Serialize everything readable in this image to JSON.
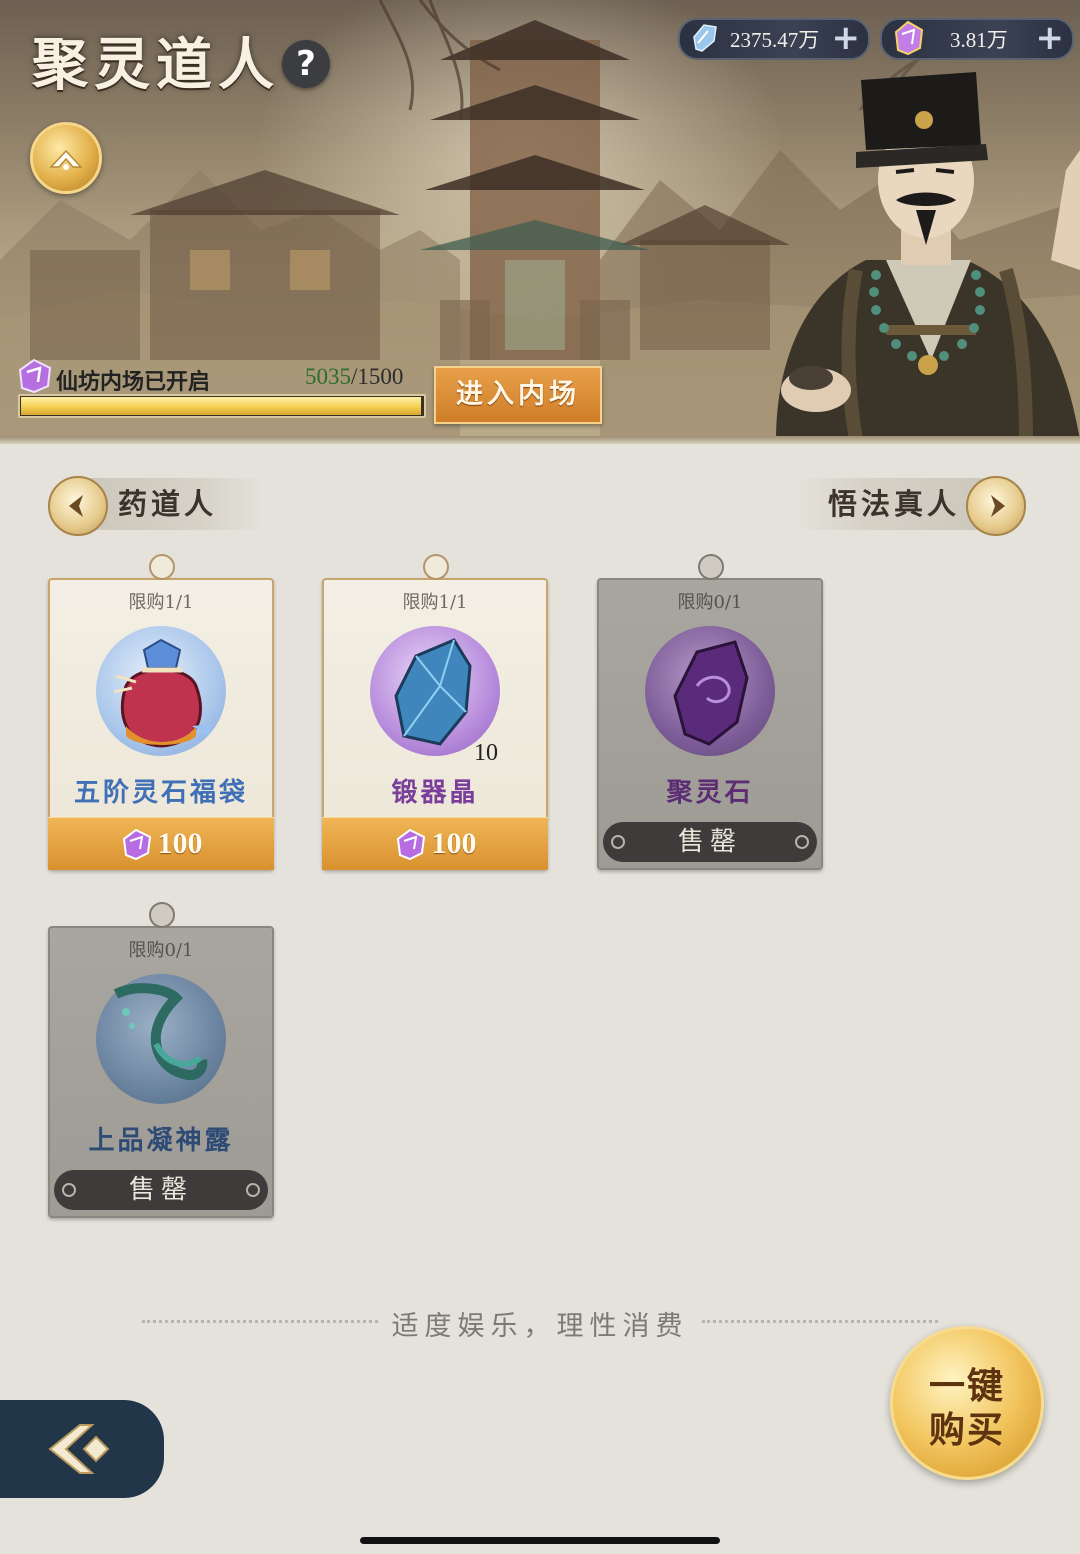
{
  "header": {
    "title": "聚灵道人",
    "help_icon": "?"
  },
  "currencies": [
    {
      "icon": "spirit-stone-icon",
      "value": "2375.47万"
    },
    {
      "icon": "purple-crystal-icon",
      "value": "3.81万"
    }
  ],
  "inner_venue": {
    "status": "仙坊内场已开启",
    "current": "5035",
    "total": "/1500",
    "progress_fraction": 1.0,
    "enter_label": "进入内场"
  },
  "nav": {
    "prev_label": "药道人",
    "next_label": "悟法真人"
  },
  "items": [
    {
      "limit": "限购1/1",
      "name": "五阶灵石福袋",
      "name_color": "#3f6fb6",
      "price": "100",
      "sold_out": false,
      "qty": ""
    },
    {
      "limit": "限购1/1",
      "name": "锻器晶",
      "name_color": "#7a3f9a",
      "price": "100",
      "sold_out": false,
      "qty": "10"
    },
    {
      "limit": "限购0/1",
      "name": "聚灵石",
      "name_color": "#5c2c74",
      "price": "",
      "sold_out": true,
      "sold_label": "售罄",
      "qty": ""
    },
    {
      "limit": "限购0/1",
      "name": "上品凝神露",
      "name_color": "#2e4b76",
      "price": "",
      "sold_out": true,
      "sold_label": "售罄",
      "qty": ""
    }
  ],
  "footer": {
    "slogan": "适度娱乐，理性消费",
    "buy_all_line1": "一键",
    "buy_all_line2": "购买"
  }
}
